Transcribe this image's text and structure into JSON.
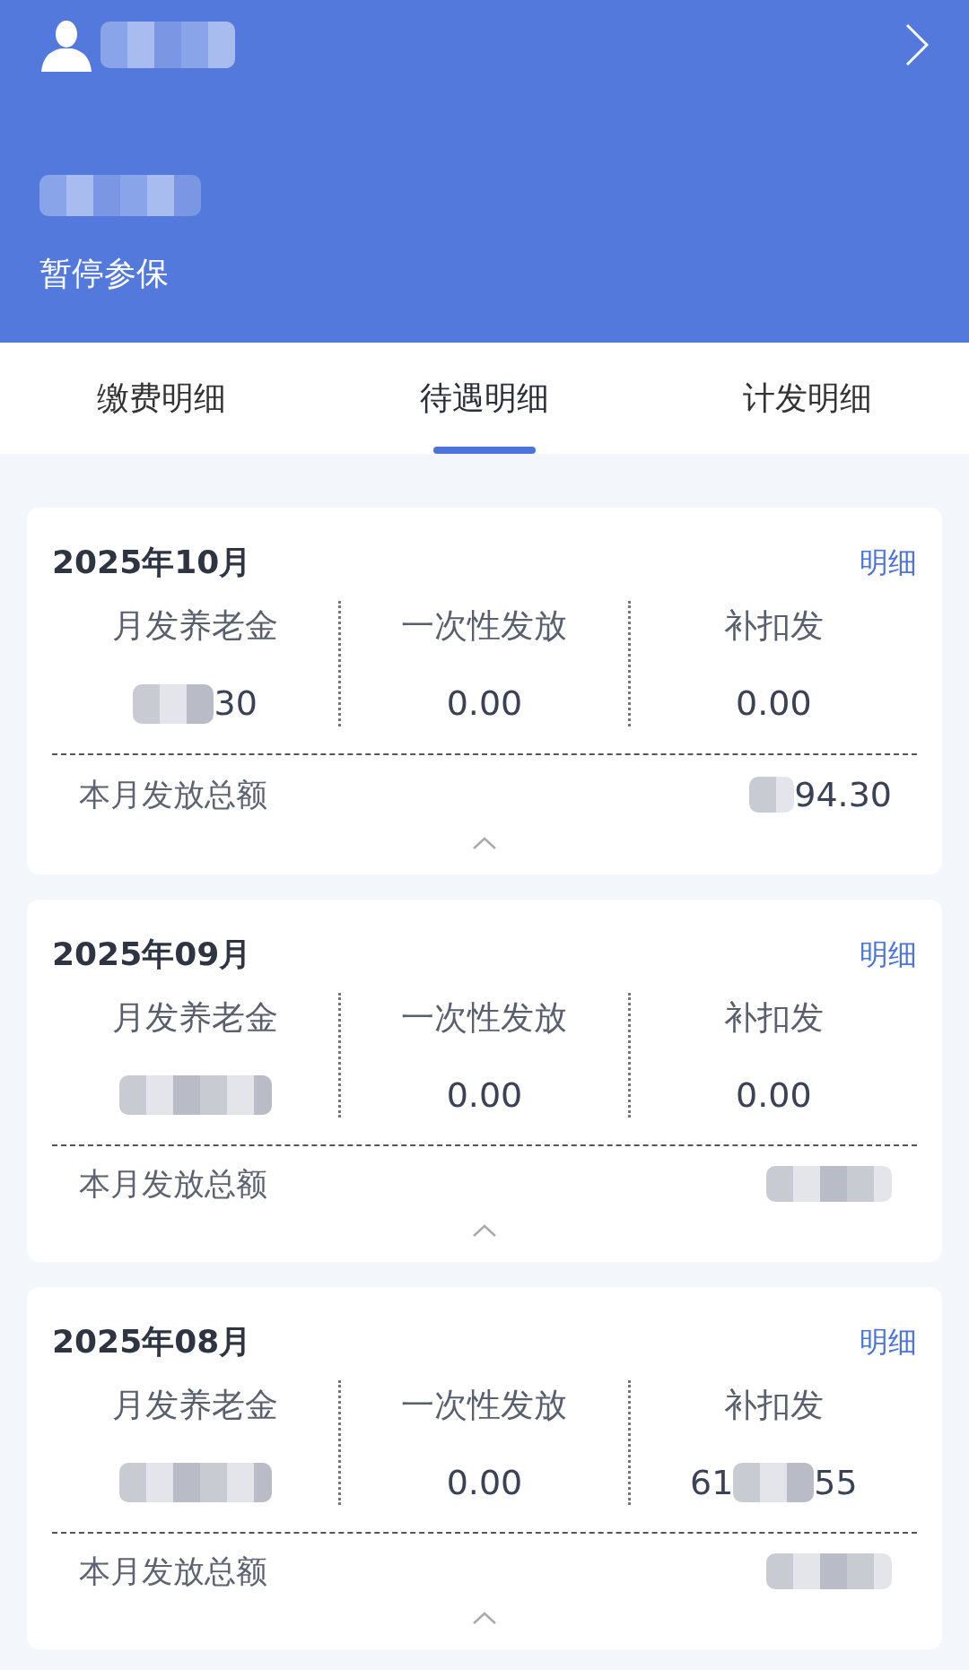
{
  "header": {
    "user_parts": [
      {
        "kind": "blur"
      }
    ],
    "sub_parts": [
      {
        "kind": "blur"
      }
    ],
    "status": "暂停参保"
  },
  "tabs": [
    {
      "label": "缴费明细",
      "selected": false
    },
    {
      "label": "待遇明细",
      "selected": true
    },
    {
      "label": "计发明细",
      "selected": false
    }
  ],
  "cards": [
    {
      "month": "2025年10月",
      "detail_link": "明细",
      "columns": [
        {
          "label": "月发养老金",
          "parts": [
            {
              "kind": "blur"
            },
            {
              "kind": "text",
              "text": "30"
            }
          ]
        },
        {
          "label": "一次性发放",
          "parts": [
            {
              "kind": "text",
              "text": "0.00"
            }
          ]
        },
        {
          "label": "补扣发",
          "parts": [
            {
              "kind": "text",
              "text": "0.00"
            }
          ]
        }
      ],
      "total_label": "本月发放总额",
      "total_parts": [
        {
          "kind": "blur"
        },
        {
          "kind": "text",
          "text": "94.30"
        }
      ]
    },
    {
      "month": "2025年09月",
      "detail_link": "明细",
      "columns": [
        {
          "label": "月发养老金",
          "parts": [
            {
              "kind": "blur"
            }
          ]
        },
        {
          "label": "一次性发放",
          "parts": [
            {
              "kind": "text",
              "text": "0.00"
            }
          ]
        },
        {
          "label": "补扣发",
          "parts": [
            {
              "kind": "text",
              "text": "0.00"
            }
          ]
        }
      ],
      "total_label": "本月发放总额",
      "total_parts": [
        {
          "kind": "blur"
        }
      ]
    },
    {
      "month": "2025年08月",
      "detail_link": "明细",
      "columns": [
        {
          "label": "月发养老金",
          "parts": [
            {
              "kind": "blur"
            }
          ]
        },
        {
          "label": "一次性发放",
          "parts": [
            {
              "kind": "text",
              "text": "0.00"
            }
          ]
        },
        {
          "label": "补扣发",
          "parts": [
            {
              "kind": "text",
              "text": "61"
            },
            {
              "kind": "blur"
            },
            {
              "kind": "text",
              "text": "55"
            }
          ]
        }
      ],
      "total_label": "本月发放总额",
      "total_parts": [
        {
          "kind": "blur"
        }
      ]
    }
  ]
}
